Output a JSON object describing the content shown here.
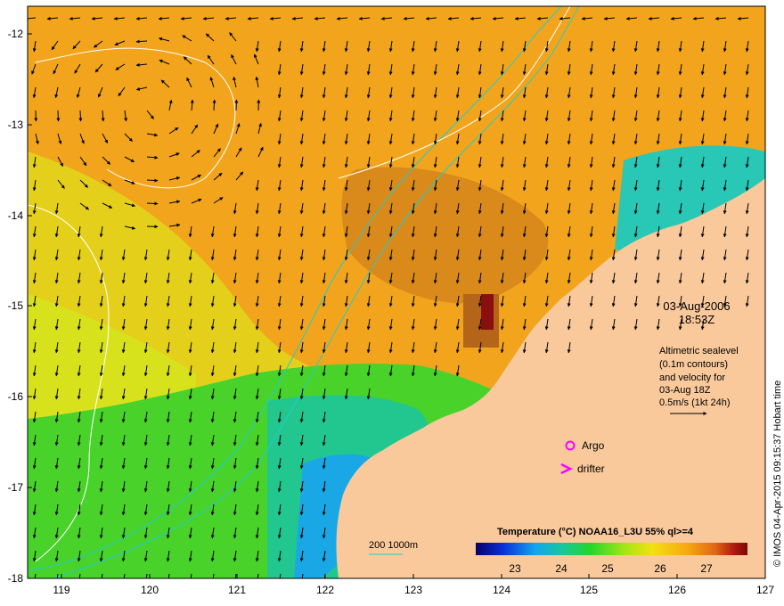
{
  "map": {
    "date_line1": "03-Aug-2006",
    "date_line2": "18:53Z",
    "note": {
      "line1": "Altimetric sealevel",
      "line2": "(0.1m contours)",
      "line3": "and velocity for",
      "line4": "03-Aug 18Z",
      "line5": "0.5m/s (1kt 24h)"
    },
    "legend": {
      "argo_label": "Argo",
      "drifter_label": "drifter",
      "argo_color": "#ff00ff",
      "drifter_color": "#ff00ff",
      "bathy_label": "200  1000m",
      "bathy_color": "#22cccc"
    },
    "colorbar": {
      "title": "Temperature (°C) NOAA16_L3U 55% ql>=4",
      "ticks": [
        "23",
        "24",
        "25",
        "26",
        "27"
      ],
      "colors": [
        "#08006a",
        "#0a2fd8",
        "#12a6ee",
        "#19c79a",
        "#22d62a",
        "#a6e616",
        "#f3e012",
        "#f6a812",
        "#e06814",
        "#b01a10",
        "#7a0808"
      ]
    },
    "credit": "© IMOS 04-Apr-2015 09:15:37 Hobart time",
    "x_axis_ticks": [
      "119",
      "120",
      "121",
      "122",
      "123",
      "124",
      "125",
      "126",
      "127"
    ],
    "y_axis_ticks": [
      "-12",
      "-13",
      "-14",
      "-15",
      "-16",
      "-17",
      "-18"
    ],
    "x_range": [
      118.6,
      127.0
    ],
    "y_range": [
      -18.0,
      -11.7
    ],
    "land_color": "#f9c99b",
    "colors": {
      "warm": "#f3a21b",
      "hot": "#d97a18",
      "yellow": "#e6de1a",
      "green": "#3fd22a",
      "cyan": "#19c7b5",
      "deep": "#0a1f9f"
    }
  }
}
